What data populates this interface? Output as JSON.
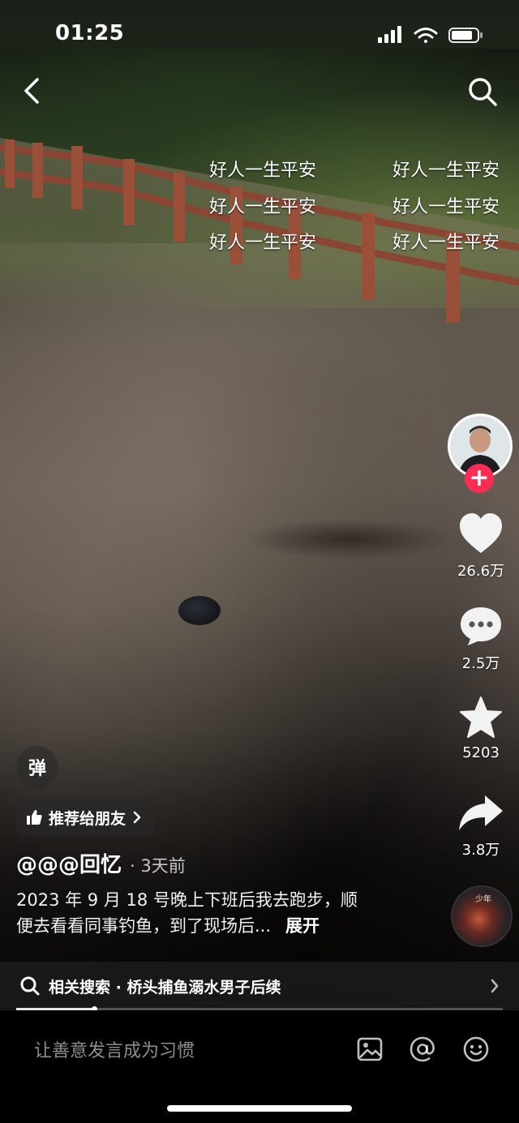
{
  "status_bar": {
    "time": "01:25"
  },
  "danmaku": [
    {
      "text": "好人一生平安"
    },
    {
      "text": "好人一生平安"
    },
    {
      "text": "好人一生平安"
    },
    {
      "text": "好人一生平安"
    },
    {
      "text": "好人一生平安"
    },
    {
      "text": "好人一生平安"
    }
  ],
  "actions": {
    "like_count": "26.6万",
    "comment_count": "2.5万",
    "favorite_count": "5203",
    "share_count": "3.8万"
  },
  "music_disc_label": "少年",
  "danmu_toggle_label": "弹",
  "recommend_label": "推荐给朋友",
  "author": {
    "name": "@@@回忆",
    "time": "· 3天前"
  },
  "caption": {
    "line1": "2023 年 9 月 18 号晚上下班后我去跑步，顺",
    "line2": "便去看看同事钓鱼，到了现场后...",
    "expand": "展开"
  },
  "related_search": {
    "text": "相关搜索 · 桥头捕鱼溺水男子后续"
  },
  "playback_progress": 0.16,
  "comment_bar": {
    "placeholder": "让善意发言成为习惯"
  },
  "colors": {
    "follow_accent": "#fe2c55",
    "background": "#000000"
  },
  "icons": [
    "back-icon",
    "search-icon",
    "like-heart-icon",
    "comment-icon",
    "favorite-star-icon",
    "share-icon",
    "thumbs-up-icon",
    "image-icon",
    "at-icon",
    "emoji-icon"
  ]
}
